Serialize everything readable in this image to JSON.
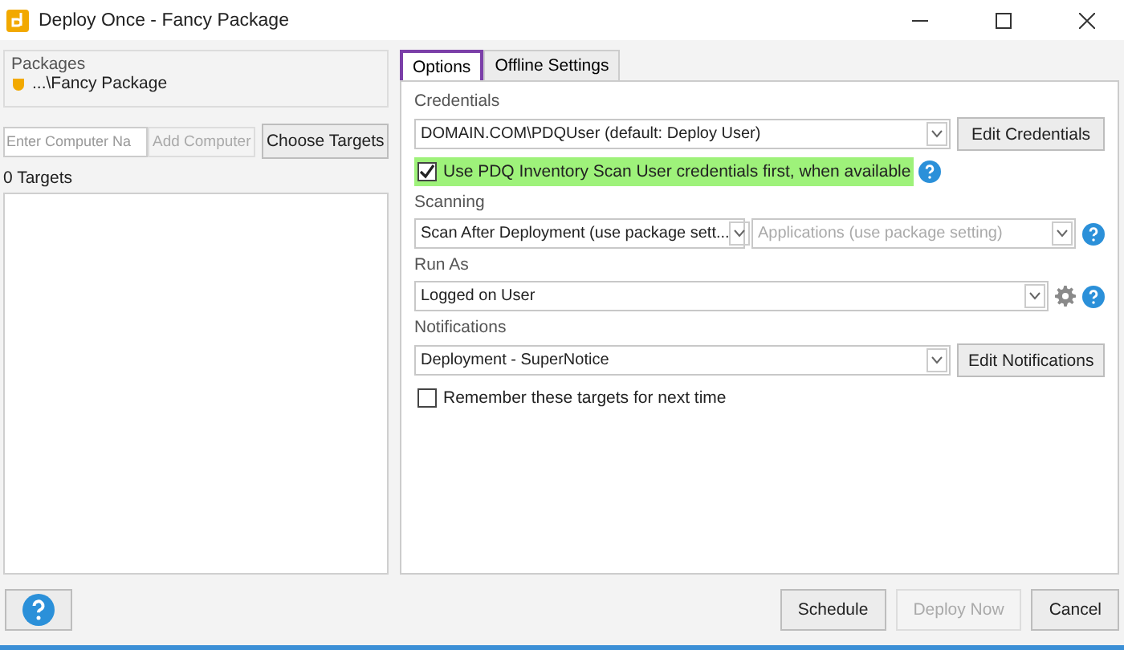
{
  "window": {
    "title": "Deploy Once - Fancy Package"
  },
  "packages": {
    "label": "Packages",
    "items": [
      "...\\Fancy Package"
    ]
  },
  "computer_field": {
    "placeholder": "Enter Computer Na"
  },
  "add_button": {
    "label": "Add Computer",
    "disabled": true
  },
  "choose_button": {
    "label": "Choose Targets"
  },
  "targets_count": "0 Targets",
  "tabs": [
    {
      "label": "Options",
      "selected": true
    },
    {
      "label": "Offline Settings",
      "selected": false
    }
  ],
  "credentials": {
    "label": "Credentials",
    "value": "DOMAIN.COM\\PDQUser (default: Deploy User)",
    "button": "Edit Credentials"
  },
  "scan_user_checkbox": {
    "label": "Use PDQ Inventory Scan User credentials first, when available",
    "checked": true,
    "highlighted": true
  },
  "scanning": {
    "label": "Scanning",
    "value": "Scan After Deployment (use package sett...",
    "secondary": {
      "value": "Applications (use package setting)",
      "disabled": true
    }
  },
  "run_as": {
    "label": "Run As",
    "value": "Logged on User"
  },
  "notifications": {
    "label": "Notifications",
    "value": "Deployment - SuperNotice",
    "button": "Edit Notifications"
  },
  "remember_checkbox": {
    "label": "Remember these targets for next time",
    "checked": false
  },
  "footer": {
    "buttons": [
      {
        "label": "Schedule",
        "disabled": false
      },
      {
        "label": "Deploy Now",
        "disabled": true
      },
      {
        "label": "Cancel",
        "disabled": false
      }
    ]
  }
}
